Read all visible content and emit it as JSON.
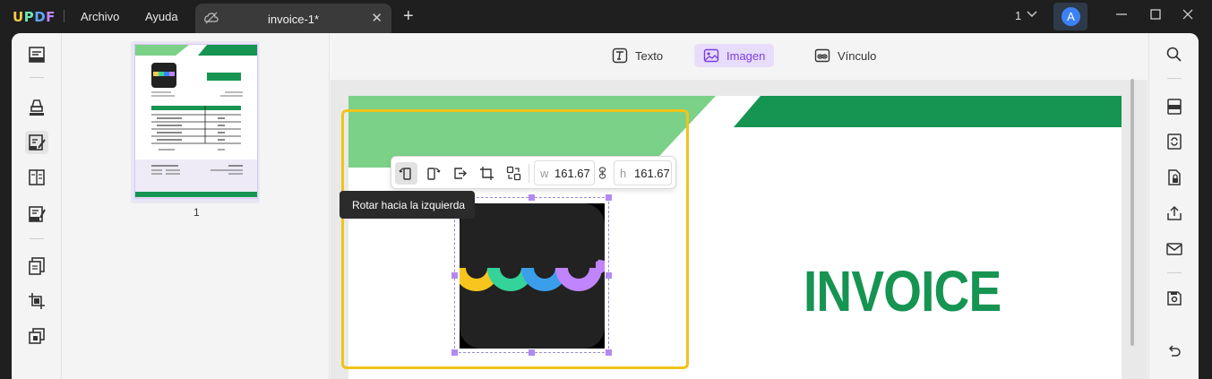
{
  "app": {
    "logo_text": "UPDF",
    "menu": {
      "file": "Archivo",
      "help": "Ayuda"
    },
    "tab": {
      "title": "invoice-1*",
      "close": "✕",
      "new_tab": "+"
    },
    "page_selector": "1",
    "avatar_letter": "A"
  },
  "toolbar": {
    "text_label": "Texto",
    "image_label": "Imagen",
    "link_label": "Vínculo",
    "active_mode": "Imagen"
  },
  "thumbnails": [
    {
      "page_number": "1"
    }
  ],
  "image_toolbar": {
    "width_label": "w",
    "width_value": "161.67",
    "height_label": "h",
    "height_value": "161.67",
    "tooltip": "Rotar hacia la izquierda"
  },
  "document": {
    "heading": "INVOICE"
  },
  "colors": {
    "accent_purple": "#7b3fe0",
    "invoice_green": "#169451",
    "light_green": "#7bd187",
    "selection_yellow": "#f0c419"
  }
}
